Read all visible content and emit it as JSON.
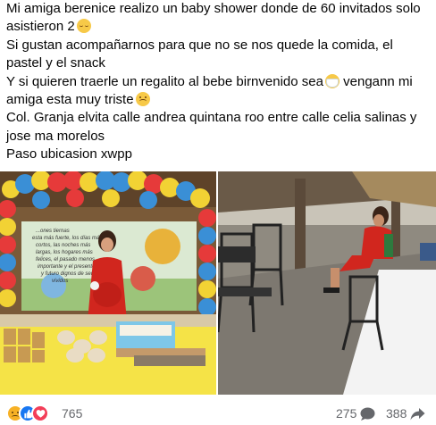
{
  "post": {
    "lines": [
      "Mi amiga berenice realizo un baby shower donde de 60 invitados solo",
      "asistieron 2",
      "Si gustan acompañarnos para que no se nos quede la comida, el",
      "pastel y el snack",
      "Y si quieren traerle un regalito al bebe birnvenido sea",
      " vengann mi",
      "amiga esta muy triste",
      "Col. Granja elvita calle andrea quintana roo entre calle celia salinas y",
      "jose ma morelos",
      "Paso ubicasion xwpp"
    ],
    "emojis": [
      "pensive-face-icon",
      "face-with-mask-icon",
      "sad-face-icon"
    ]
  },
  "photos": {
    "left": {
      "banner_text": [
        "...ones tiernas",
        "esta más fuerte, los días más",
        "cortos, las noches más",
        "largas, los hogares más",
        "felices, el pasado menos",
        "importante y el presente",
        "y futuro dignos de ser",
        "vividos"
      ]
    },
    "right": {}
  },
  "stats": {
    "reactions": [
      "sad-reaction-icon",
      "like-reaction-icon",
      "love-reaction-icon"
    ],
    "reaction_count": "765",
    "comment_count": "275",
    "share_count": "388"
  },
  "colors": {
    "text": "#050505",
    "muted": "#65676b",
    "like": "#1877f2",
    "love": "#f33e58",
    "sad": "#f7b125"
  }
}
